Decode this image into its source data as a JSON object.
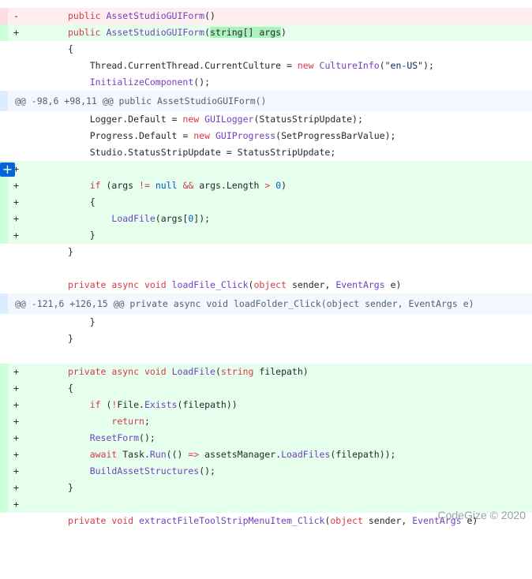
{
  "hunks": [
    {
      "header": "@@ -98,6 +98,11 @@ public AssetStudioGUIForm()"
    },
    {
      "header": "@@ -121,6 +126,15 @@ private async void loadFolder_Click(object sender, EventArgs e)"
    }
  ],
  "signs": {
    "del": "-",
    "add": "+"
  },
  "lines": {
    "l1": {
      "a": "public ",
      "b": "AssetStudioGUIForm",
      "c": "()"
    },
    "l2": {
      "a": "public ",
      "b": "AssetStudioGUIForm",
      "c": "(",
      "d": "string[] args",
      "e": ")"
    },
    "l3": {
      "a": "{"
    },
    "l4": {
      "a": "    Thread.CurrentThread.CurrentCulture = ",
      "b": "new",
      "c": " ",
      "d": "CultureInfo",
      "e": "(",
      "f": "\"en-US\"",
      "g": ");"
    },
    "l5": {
      "a": "    ",
      "b": "InitializeComponent",
      "c": "();"
    },
    "l6": {
      "a": "    Logger.Default = ",
      "b": "new",
      "c": " ",
      "d": "GUILogger",
      "e": "(StatusStripUpdate);"
    },
    "l7": {
      "a": "    Progress.Default = ",
      "b": "new",
      "c": " ",
      "d": "GUIProgress",
      "e": "(SetProgressBarValue);"
    },
    "l8": {
      "a": "    Studio.StatusStripUpdate = StatusStripUpdate;"
    },
    "l9": {
      "a": ""
    },
    "l10": {
      "a": "    ",
      "b": "if",
      "c": " (args ",
      "d": "!=",
      "e": " ",
      "f": "null",
      "g": " ",
      "h": "&&",
      "i": " args.Length ",
      "j": ">",
      "k": " ",
      "l": "0",
      "m": ")"
    },
    "l11": {
      "a": "    {"
    },
    "l12": {
      "a": "        ",
      "b": "LoadFile",
      "c": "(args[",
      "d": "0",
      "e": "]);"
    },
    "l13": {
      "a": "    }"
    },
    "l14": {
      "a": "}"
    },
    "l15": {
      "a": ""
    },
    "l16": {
      "a": "private ",
      "b": "async",
      "c": " ",
      "d": "void",
      "e": " ",
      "f": "loadFile_Click",
      "g": "(",
      "h": "object",
      "i": " sender, ",
      "j": "EventArgs",
      "k": " e)"
    },
    "l17": {
      "a": "    }"
    },
    "l18": {
      "a": "}"
    },
    "l19": {
      "a": ""
    },
    "l20": {
      "a": "private ",
      "b": "async",
      "c": " ",
      "d": "void",
      "e": " ",
      "f": "LoadFile",
      "g": "(",
      "h": "string",
      "i": " filepath)"
    },
    "l21": {
      "a": "{"
    },
    "l22": {
      "a": "    ",
      "b": "if",
      "c": " (",
      "d": "!",
      "e": "File.",
      "f": "Exists",
      "g": "(filepath))"
    },
    "l23": {
      "a": "        ",
      "b": "return",
      "c": ";"
    },
    "l24": {
      "a": "    ",
      "b": "ResetForm",
      "c": "();"
    },
    "l25": {
      "a": "    ",
      "b": "await",
      "c": " Task.",
      "d": "Run",
      "e": "(() ",
      "f": "=>",
      "g": " assetsManager.",
      "h": "LoadFiles",
      "i": "(filepath));"
    },
    "l26": {
      "a": "    ",
      "b": "BuildAssetStructures",
      "c": "();"
    },
    "l27": {
      "a": "}"
    },
    "l28": {
      "a": ""
    },
    "l29": {
      "a": "private ",
      "b": "void",
      "c": " ",
      "d": "extractFileToolStripMenuItem_Click",
      "e": "(",
      "f": "object",
      "g": " sender, ",
      "h": "EventArgs",
      "i": " e)"
    }
  },
  "add_comment_icon": "plus-icon",
  "add_comment_glyph": "+",
  "watermark": "CodeGize © 2020"
}
